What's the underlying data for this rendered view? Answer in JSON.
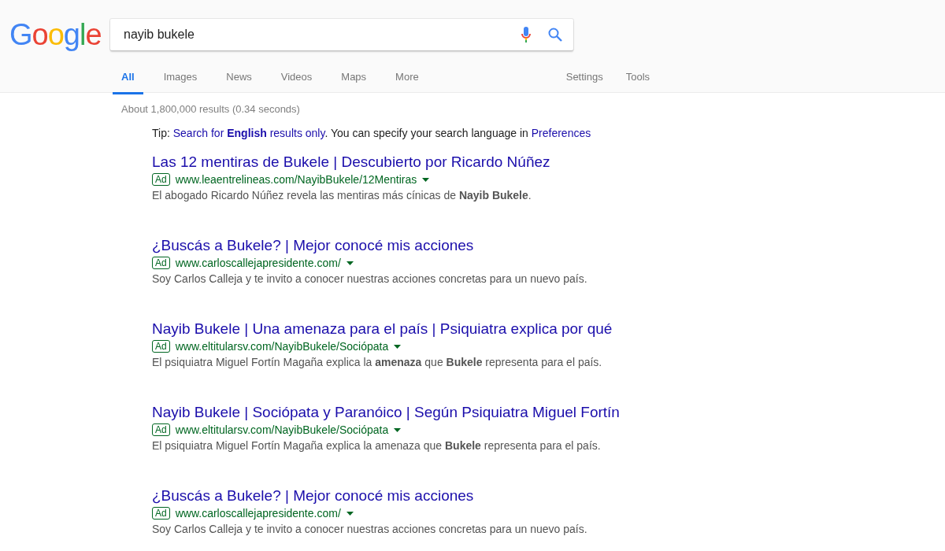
{
  "logo": "Google",
  "search": {
    "value": "nayib bukele"
  },
  "tabs": [
    {
      "label": "All",
      "selected": true
    },
    {
      "label": "Images",
      "selected": false
    },
    {
      "label": "News",
      "selected": false
    },
    {
      "label": "Videos",
      "selected": false
    },
    {
      "label": "Maps",
      "selected": false
    },
    {
      "label": "More",
      "selected": false
    }
  ],
  "tools": [
    "Settings",
    "Tools"
  ],
  "stats": "About 1,800,000 results (0.34 seconds)",
  "tip": {
    "prefix": "Tip:",
    "link": "Search for **English** results only",
    "middle": ". You can specify your search language in",
    "link2": "Preferences"
  },
  "results": [
    {
      "title": "Las 12 mentiras de Bukele | Descubierto por Ricardo Núñez",
      "badge": "Ad",
      "url": "www.leaentrelineas.com/NayibBukele/12Mentiras",
      "description": "El abogado Ricardo Núñez revela las mentiras más cínicas de **Nayib Bukele**."
    },
    {
      "title": "¿Buscás a Bukele? | Mejor conocé mis acciones",
      "badge": "Ad",
      "url": "www.carloscallejapresidente.com/",
      "description": "Soy Carlos Calleja y te invito a conocer nuestras acciones concretas para un nuevo país."
    },
    {
      "title": "Nayib Bukele | Una amenaza para el país | Psiquiatra explica por qué",
      "badge": "Ad",
      "url": "www.eltitularsv.com/NayibBukele/Sociópata",
      "description": "El psiquiatra Miguel Fortín Magaña explica la **amenaza** que **Bukele** representa para el país."
    },
    {
      "title": "Nayib Bukele | Sociópata y Paranóico | Según Psiquiatra Miguel Fortín",
      "badge": "Ad",
      "url": "www.eltitularsv.com/NayibBukele/Sociópata",
      "description": "El psiquiatra Miguel Fortín Magaña explica la amenaza que **Bukele** representa para el país."
    },
    {
      "title": "¿Buscás a Bukele? | Mejor conocé mis acciones",
      "badge": "Ad",
      "url": "www.carloscallejapresidente.com/",
      "description": "Soy Carlos Calleja y te invito a conocer nuestras acciones concretas para un nuevo país."
    }
  ]
}
